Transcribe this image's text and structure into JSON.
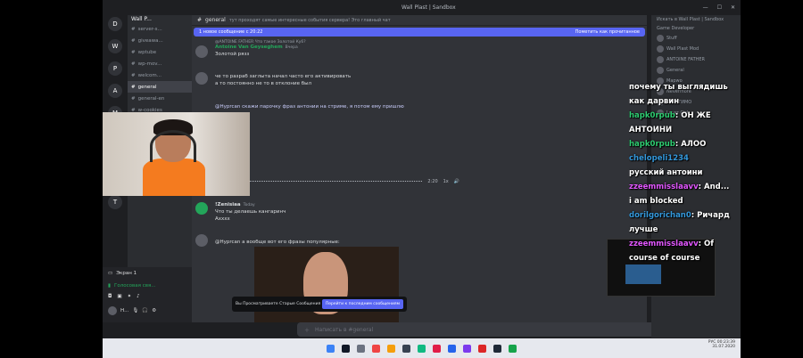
{
  "window": {
    "title": "Wall Plast | Sandbox",
    "tab_title": "Wall Plast | Sandbox"
  },
  "server_rail": {
    "servers": [
      "D",
      "W",
      "P",
      "A",
      "M",
      "S",
      "R",
      "C",
      "T"
    ]
  },
  "channel_sidebar": {
    "server_name": "Wall P...",
    "channels": [
      {
        "label": "server-s...",
        "active": false
      },
      {
        "label": "giveawa...",
        "active": false
      },
      {
        "label": "wptube",
        "active": false
      },
      {
        "label": "wp-mov...",
        "active": false
      },
      {
        "label": "welcom...",
        "active": false
      },
      {
        "label": "general",
        "active": true
      },
      {
        "label": "general-en",
        "active": false
      },
      {
        "label": "w-cookies",
        "active": false
      },
      {
        "label": "concepts",
        "active": false
      },
      {
        "label": "worksh...",
        "active": false
      },
      {
        "label": "game-...",
        "active": false
      },
      {
        "label": "fan-art...",
        "active": false
      }
    ],
    "category": "Стрим",
    "voice_label": "Экран 1",
    "voice_status": "Голосовая свя...",
    "user_name": "Н...",
    "new_badge": "НОВОЕ"
  },
  "main": {
    "channel_name": "general",
    "topic": "тут проходят самые интересные события сервера! Это главный чат",
    "new_messages_bar": "1 новое сообщение с 20:22",
    "mark_read": "Пометить как прочитанное",
    "messages": [
      {
        "reply": "@ANTOINE FATHER Что такое Золотой Ку6?",
        "name": "Antoine Van Geyseghem",
        "time": "Вчера",
        "text": "Золотой рязз",
        "color": "#f0b232"
      },
      {
        "name": "",
        "time": "",
        "text": "че то разраб заглыта начал часто его активировать",
        "text2": "а то постоянно не то в отклоние был",
        "color": "#f23f43"
      },
      {
        "reply": "@Hyprcan скажи парочку фраз антонии на стриме, я потом ему пришлю",
        "name": "",
        "time": "",
        "text": "",
        "color": "#dbdee1"
      },
      {
        "name": "!Zenisiaa",
        "time": "Today",
        "text": "Что ты делаешь кангаринч",
        "text2": "Ахххх",
        "color": "#dbdee1"
      },
      {
        "name": "",
        "time": "",
        "text": "@Hyprcan а вообще вот его фразы популярные:",
        "color": "#f23f43"
      }
    ],
    "audio_time": "2:20",
    "audio_speed": "1x",
    "toast_text": "Вы Просматриваете Старые Сообщения",
    "toast_button": "Перейти к последним сообщениям",
    "composer_placeholder": "Написать в #general"
  },
  "members": {
    "search": "Искать в Wall Plast | Sandbox",
    "group": "Game Developer",
    "items": [
      "Stuff",
      "Wall Plast Mod",
      "ANTOINE FATHER",
      "General",
      "Mapwo",
      "Nevermore",
      "СМП ТИМО",
      "Lover Girl"
    ]
  },
  "chat_overlay": [
    {
      "text": "почему ты выглядишь",
      "color": "#ffffff"
    },
    {
      "text": "как дарвин",
      "color": "#ffffff"
    },
    {
      "user": "hapk0rpub",
      "text": ": ОН ЖЕ",
      "color": "#2ecc71"
    },
    {
      "text": "АНТОИНИ",
      "color": "#ffffff"
    },
    {
      "user": "hapk0rpub",
      "text": ": АЛОО",
      "color": "#2ecc71"
    },
    {
      "user": "chelopeli1234",
      "text": "",
      "color": "#3498db"
    },
    {
      "text": "русский антоини",
      "color": "#ffffff"
    },
    {
      "user": "zzeemmisslaavv",
      "text": ": And...",
      "color": "#e056fd"
    },
    {
      "text": "i am blocked",
      "color": "#ffffff"
    },
    {
      "user": "dorilgorichan0",
      "text": ": Ричард",
      "color": "#3498db"
    },
    {
      "text": "лучше",
      "color": "#ffffff"
    },
    {
      "user": "zzeemmisslaavv",
      "text": ": Of",
      "color": "#e056fd"
    },
    {
      "text": "course of course",
      "color": "#ffffff"
    }
  ],
  "taskbar": {
    "language": "РУС",
    "time": "00:23:39",
    "date": "31.07.2020",
    "icons": [
      "#3b82f6",
      "#111827",
      "#6b7280",
      "#ef4444",
      "#f59e0b",
      "#374151",
      "#10b981",
      "#e11d48",
      "#2563eb",
      "#7c3aed",
      "#dc2626",
      "#1f2937",
      "#16a34a"
    ]
  }
}
